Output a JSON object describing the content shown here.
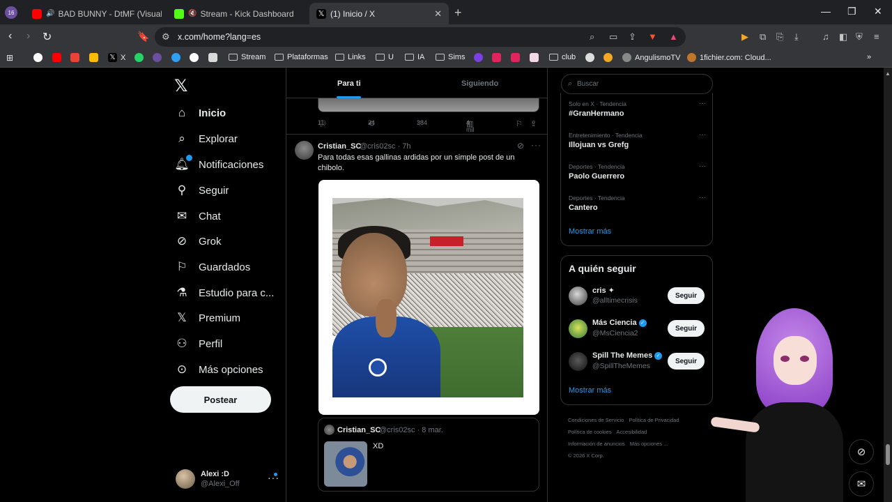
{
  "browser": {
    "profile_badge": "16",
    "tabs": [
      {
        "title": "BAD BUNNY - DtMF (Visualizer) |",
        "icon": "youtube-icon",
        "color": "#ff0000"
      },
      {
        "title": "Stream - Kick Dashboard",
        "icon": "kick-icon",
        "color": "#53fc18"
      },
      {
        "title": "(1) Inicio / X",
        "icon": "x-icon",
        "color": "#ffffff"
      }
    ],
    "url": "x.com/home?lang=es",
    "bookmarks": [
      {
        "label": "X",
        "type": "site"
      },
      {
        "label": "Stream",
        "type": "folder"
      },
      {
        "label": "Plataformas",
        "type": "folder"
      },
      {
        "label": "Links",
        "type": "folder"
      },
      {
        "label": "U",
        "type": "folder"
      },
      {
        "label": "IA",
        "type": "folder"
      },
      {
        "label": "Sims",
        "type": "folder"
      },
      {
        "label": "club",
        "type": "folder"
      },
      {
        "label": "AngulismoTV",
        "type": "site"
      },
      {
        "label": "1fichier.com: Cloud...",
        "type": "site"
      }
    ]
  },
  "nav": {
    "items": [
      {
        "label": "Inicio",
        "icon": "home-icon"
      },
      {
        "label": "Explorar",
        "icon": "search-icon"
      },
      {
        "label": "Notificaciones",
        "icon": "bell-icon"
      },
      {
        "label": "Seguir",
        "icon": "follow-icon"
      },
      {
        "label": "Chat",
        "icon": "mail-icon"
      },
      {
        "label": "Grok",
        "icon": "grok-icon"
      },
      {
        "label": "Guardados",
        "icon": "bookmark-icon"
      },
      {
        "label": "Estudio para c...",
        "icon": "flask-icon"
      },
      {
        "label": "Premium",
        "icon": "x-icon"
      },
      {
        "label": "Perfil",
        "icon": "person-icon"
      },
      {
        "label": "Más opciones",
        "icon": "more-circle-icon"
      }
    ],
    "post_button": "Postear",
    "account": {
      "name": "Alexi :D",
      "handle": "@Alexi_Off"
    }
  },
  "feed": {
    "tabs": {
      "active": "Para ti",
      "inactive": "Siguiendo"
    },
    "prev_actions": {
      "replies": "11",
      "reposts": "24",
      "likes": "384",
      "views": "4 mil"
    },
    "tweet": {
      "name": "Cristian_SC",
      "meta": "@cris02sc · 7h",
      "text": "Para todas esas gallinas ardidas por un simple post de un chibolo.",
      "quote": {
        "name": "Cristian_SC",
        "meta": "@cris02sc · 8 mar.",
        "text": "XD"
      }
    }
  },
  "sidebar": {
    "search_placeholder": "Buscar",
    "trends": [
      {
        "category": "Solo en X · Tendencia",
        "name": "#GranHermano"
      },
      {
        "category": "Entretenimiento · Tendencia",
        "name": "Illojuan vs Grefg"
      },
      {
        "category": "Deportes · Tendencia",
        "name": "Paolo Guerrero"
      },
      {
        "category": "Deportes · Tendencia",
        "name": "Cantero"
      }
    ],
    "show_more": "Mostrar más",
    "who_to_follow": {
      "title": "A quién seguir",
      "users": [
        {
          "name": "cris ✦",
          "handle": "@alltimecrisis",
          "verified": false,
          "button": "Seguir"
        },
        {
          "name": "Más Ciencia",
          "handle": "@MsCiencia2",
          "verified": true,
          "button": "Seguir"
        },
        {
          "name": "Spill The Memes",
          "handle": "@SpillTheMemes",
          "verified": true,
          "button": "Seguir"
        }
      ],
      "show_more": "Mostrar más"
    },
    "footer": [
      "Condiciones de Servicio",
      "Política de Privacidad",
      "Política de cookies",
      "Accesibilidad",
      "Información de anuncios",
      "Más opciones ...",
      "© 2026 X Corp."
    ]
  }
}
